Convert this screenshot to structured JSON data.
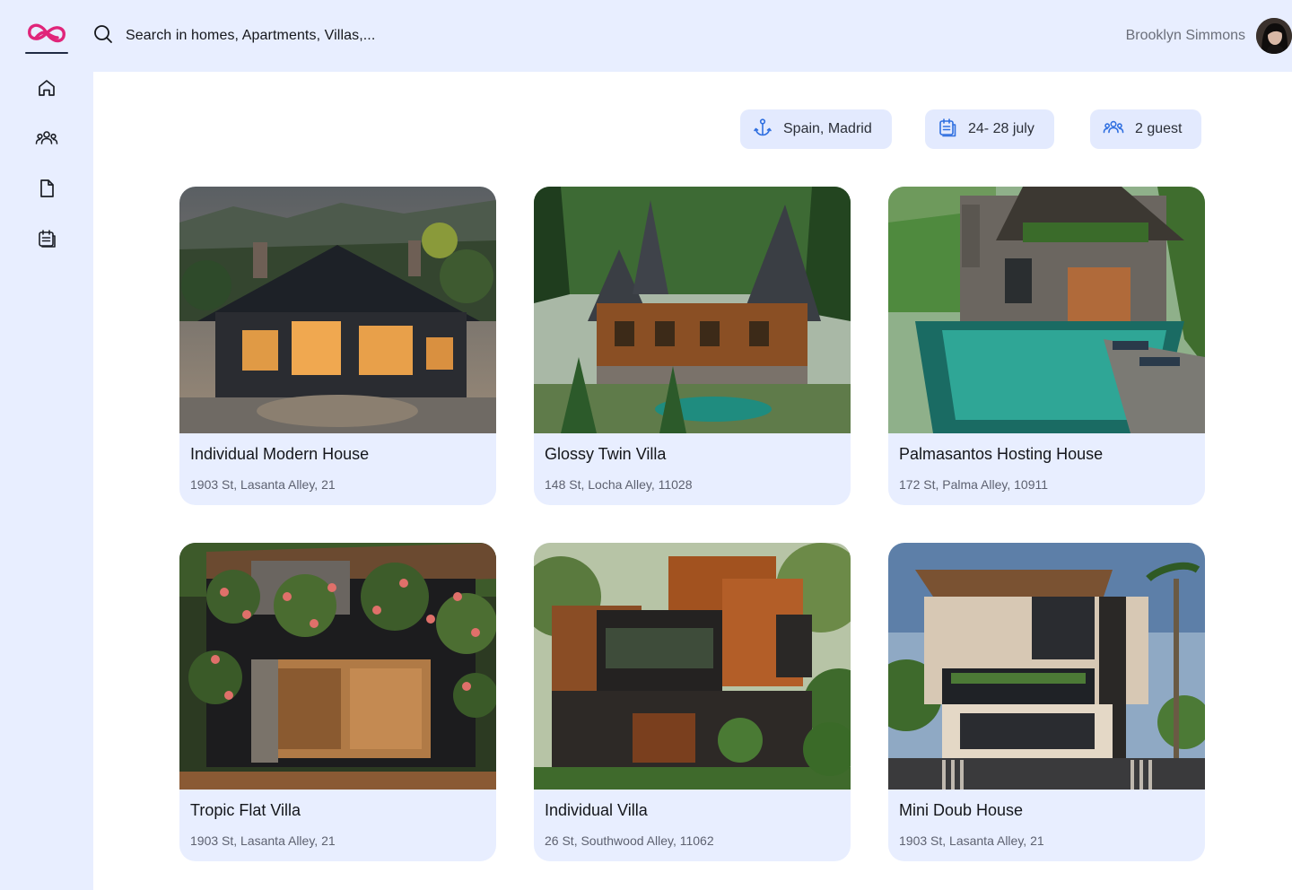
{
  "search": {
    "placeholder": "Search in homes, Apartments, Villas,..."
  },
  "user": {
    "name": "Brooklyn Simmons"
  },
  "nav": [
    {
      "icon": "home-icon"
    },
    {
      "icon": "users-icon"
    },
    {
      "icon": "document-icon"
    },
    {
      "icon": "bookings-icon"
    }
  ],
  "filters": {
    "location": "Spain, Madrid",
    "dates": "24- 28 july",
    "guests": "2 guest"
  },
  "listings": [
    {
      "title": "Individual Modern House",
      "address": "1903 St, Lasanta Alley, 21"
    },
    {
      "title": "Glossy Twin Villa",
      "address": "148 St, Locha Alley, 11028"
    },
    {
      "title": "Palmasantos Hosting House",
      "address": "172 St, Palma Alley, 10911"
    },
    {
      "title": "Tropic Flat Villa",
      "address": "1903 St, Lasanta Alley, 21"
    },
    {
      "title": "Individual Villa",
      "address": "26 St, Southwood Alley, 11062"
    },
    {
      "title": "Mini Doub House",
      "address": "1903 St, Lasanta Alley, 21"
    }
  ],
  "colors": {
    "accent": "#e0257a",
    "background": "#e8eeff",
    "chip": "#e3eafe",
    "icon": "#2f6fe0"
  }
}
